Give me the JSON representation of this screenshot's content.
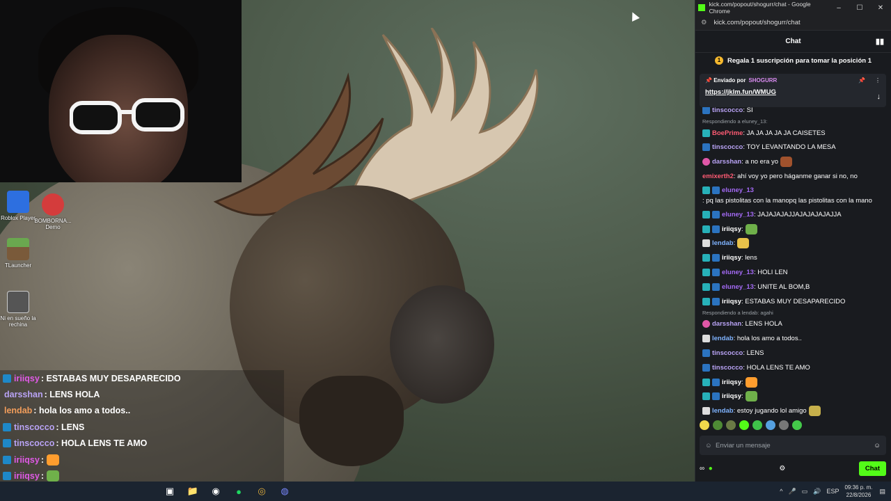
{
  "desktop": {
    "icons": [
      {
        "label": "Roblox Player",
        "icon": "roblox-icon"
      },
      {
        "label": "BOMBORNA... Demo",
        "icon": "bomb-game-icon"
      },
      {
        "label": "TLauncher",
        "icon": "minecraft-icon"
      },
      {
        "label": "Ni en sueño la rechina",
        "icon": "video-file-icon"
      }
    ]
  },
  "overlay_chat": [
    {
      "user": "iriiqsy",
      "color": "#e05ae6",
      "text": "ESTABAS MUY DESAPARECIDO",
      "badge": true
    },
    {
      "user": "darsshan",
      "color": "#b9a3f5",
      "text": "LENS HOLA",
      "badge": false
    },
    {
      "user": "lendab",
      "color": "#f29d5b",
      "text": "hola los amo a todos..",
      "badge": false
    },
    {
      "user": "tinscocco",
      "color": "#b9a3f5",
      "text": "LENS",
      "badge": true
    },
    {
      "user": "tinscocco",
      "color": "#b9a3f5",
      "text": "HOLA LENS TE AMO",
      "badge": true
    },
    {
      "user": "iriiqsy",
      "color": "#e05ae6",
      "text": "",
      "badge": true,
      "emote": "#ff9d2e"
    },
    {
      "user": "iriiqsy",
      "color": "#e05ae6",
      "text": "",
      "badge": true,
      "emote": "#6fb04a"
    },
    {
      "user": "lendab",
      "color": "#f29d5b",
      "text": "estoy jugando lol amigo",
      "badge": false,
      "emote": "#c6b04b"
    }
  ],
  "browser": {
    "window_title": "kick.com/popout/shogurr/chat - Google Chrome",
    "url": "kick.com/popout/shogurr/chat",
    "controls": [
      "–",
      "☐",
      "✕"
    ]
  },
  "chat": {
    "header": "Chat",
    "promo": "Regala 1 suscripción para tomar la posición 1",
    "promo_rank": "1",
    "pinned": {
      "label": "Enviado por",
      "author": "SHOGURR",
      "link": "https://jklm.fun/WMUG"
    },
    "messages": [
      {
        "user": "tinscocco",
        "color": "#b9a3f5",
        "text": ": SI",
        "badges": [
          "pr"
        ]
      },
      {
        "reply": "Respondiendo a eluney_13:"
      },
      {
        "user": "BoePrime",
        "color": "#ff5b73",
        "text": ": JA JA JA JA JA CAISETES",
        "badges": [
          "sub"
        ]
      },
      {
        "user": "tinscocco",
        "color": "#b9a3f5",
        "text": ": TOY LEVANTANDO LA MESA",
        "badges": [
          "pr"
        ]
      },
      {
        "user": "darsshan",
        "color": "#b9a3f5",
        "text": ": a no era yo",
        "badges": [
          "vip"
        ],
        "emote": "#a0522d"
      },
      {
        "user": "emixerth2",
        "color": "#ff5b73",
        "text": ": ahí voy yo pero háganme ganar si no, no",
        "badges": []
      },
      {
        "user": "eluney_13",
        "color": "#a46af5",
        "text": ": pq las pistolitas con la manopq las pistolitas con la mano",
        "badges": [
          "sub",
          "pr"
        ],
        "wrap": true
      },
      {
        "user": "eluney_13",
        "color": "#a46af5",
        "text": ": JAJAJAJAJJAJAJAJAJAJJA",
        "badges": [
          "sub",
          "pr"
        ]
      },
      {
        "user": "iriiqsy",
        "color": "#ffffff",
        "text": ":",
        "badges": [
          "sub",
          "pr"
        ],
        "emote": "#6fb04a"
      },
      {
        "user": "lendab",
        "color": "#7fb3ff",
        "text": ":",
        "badges": [
          "mod"
        ],
        "emote": "#e8c24a"
      },
      {
        "user": "iriiqsy",
        "color": "#ffffff",
        "text": ": lens",
        "badges": [
          "sub",
          "pr"
        ]
      },
      {
        "user": "eluney_13",
        "color": "#a46af5",
        "text": ": HOLI LEN",
        "badges": [
          "sub",
          "pr"
        ]
      },
      {
        "user": "eluney_13",
        "color": "#a46af5",
        "text": ": UNITE AL BOM,B",
        "badges": [
          "sub",
          "pr"
        ]
      },
      {
        "user": "iriiqsy",
        "color": "#ffffff",
        "text": ": ESTABAS MUY DESAPARECIDO",
        "badges": [
          "sub",
          "pr"
        ]
      },
      {
        "reply": "Respondiendo a lendab: agahi"
      },
      {
        "user": "darsshan",
        "color": "#b9a3f5",
        "text": ": LENS HOLA",
        "badges": [
          "vip"
        ]
      },
      {
        "user": "lendab",
        "color": "#7fb3ff",
        "text": ": hola los amo a todos..",
        "badges": [
          "mod"
        ]
      },
      {
        "user": "tinscocco",
        "color": "#b9a3f5",
        "text": ": LENS",
        "badges": [
          "pr"
        ]
      },
      {
        "user": "tinscocco",
        "color": "#b9a3f5",
        "text": ": HOLA LENS TE AMO",
        "badges": [
          "pr"
        ]
      },
      {
        "user": "iriiqsy",
        "color": "#ffffff",
        "text": ":",
        "badges": [
          "sub",
          "pr"
        ],
        "emote": "#ff9d2e"
      },
      {
        "user": "iriiqsy",
        "color": "#ffffff",
        "text": ":",
        "badges": [
          "sub",
          "pr"
        ],
        "emote": "#6fb04a"
      },
      {
        "user": "lendab",
        "color": "#7fb3ff",
        "text": ": estoy jugando lol amigo",
        "badges": [
          "mod"
        ],
        "emote": "#c6b04b"
      }
    ],
    "input_placeholder": "Enviar un mensaje",
    "send_label": "Chat"
  },
  "taskbar": {
    "lang": "ESP",
    "time": "09:36 p. m.",
    "date": "22/8/2026"
  },
  "colors": {
    "kick_green": "#53fc18"
  }
}
